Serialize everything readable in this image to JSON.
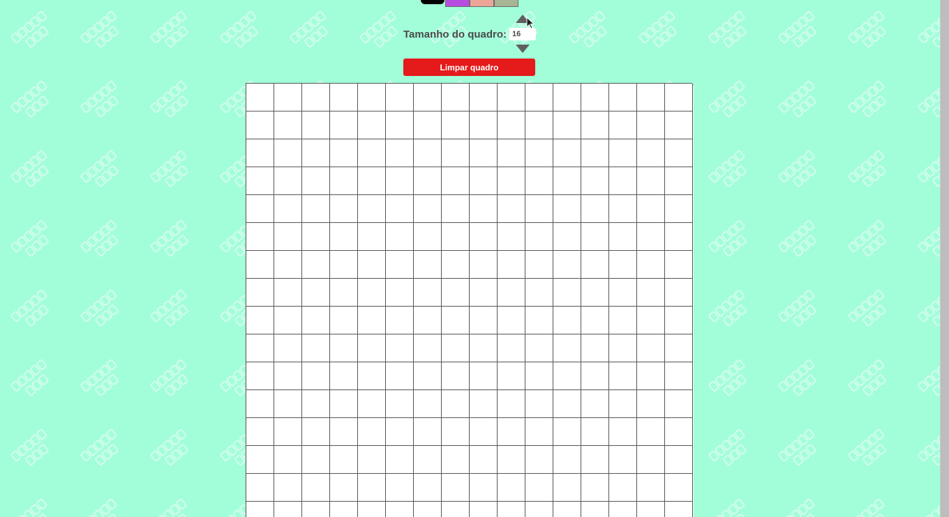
{
  "palette": {
    "colors": [
      {
        "name": "black",
        "hex": "#000000",
        "selected": true
      },
      {
        "name": "purple",
        "hex": "#b94ce0"
      },
      {
        "name": "salmon",
        "hex": "#eda598"
      },
      {
        "name": "sage",
        "hex": "#a7b595"
      }
    ]
  },
  "board_size": {
    "label": "Tamanho do quadro:",
    "value": "16",
    "increment_icon": "triangle-up-icon",
    "decrement_icon": "triangle-down-icon"
  },
  "clear_button": {
    "label": "Limpar quadro",
    "color": "#e51a1a"
  },
  "board": {
    "columns": 16,
    "visible_rows": 16,
    "pixel_color": "#ffffff"
  },
  "theme": {
    "background": "#a1fed9",
    "text_color": "#4a4a4a"
  }
}
